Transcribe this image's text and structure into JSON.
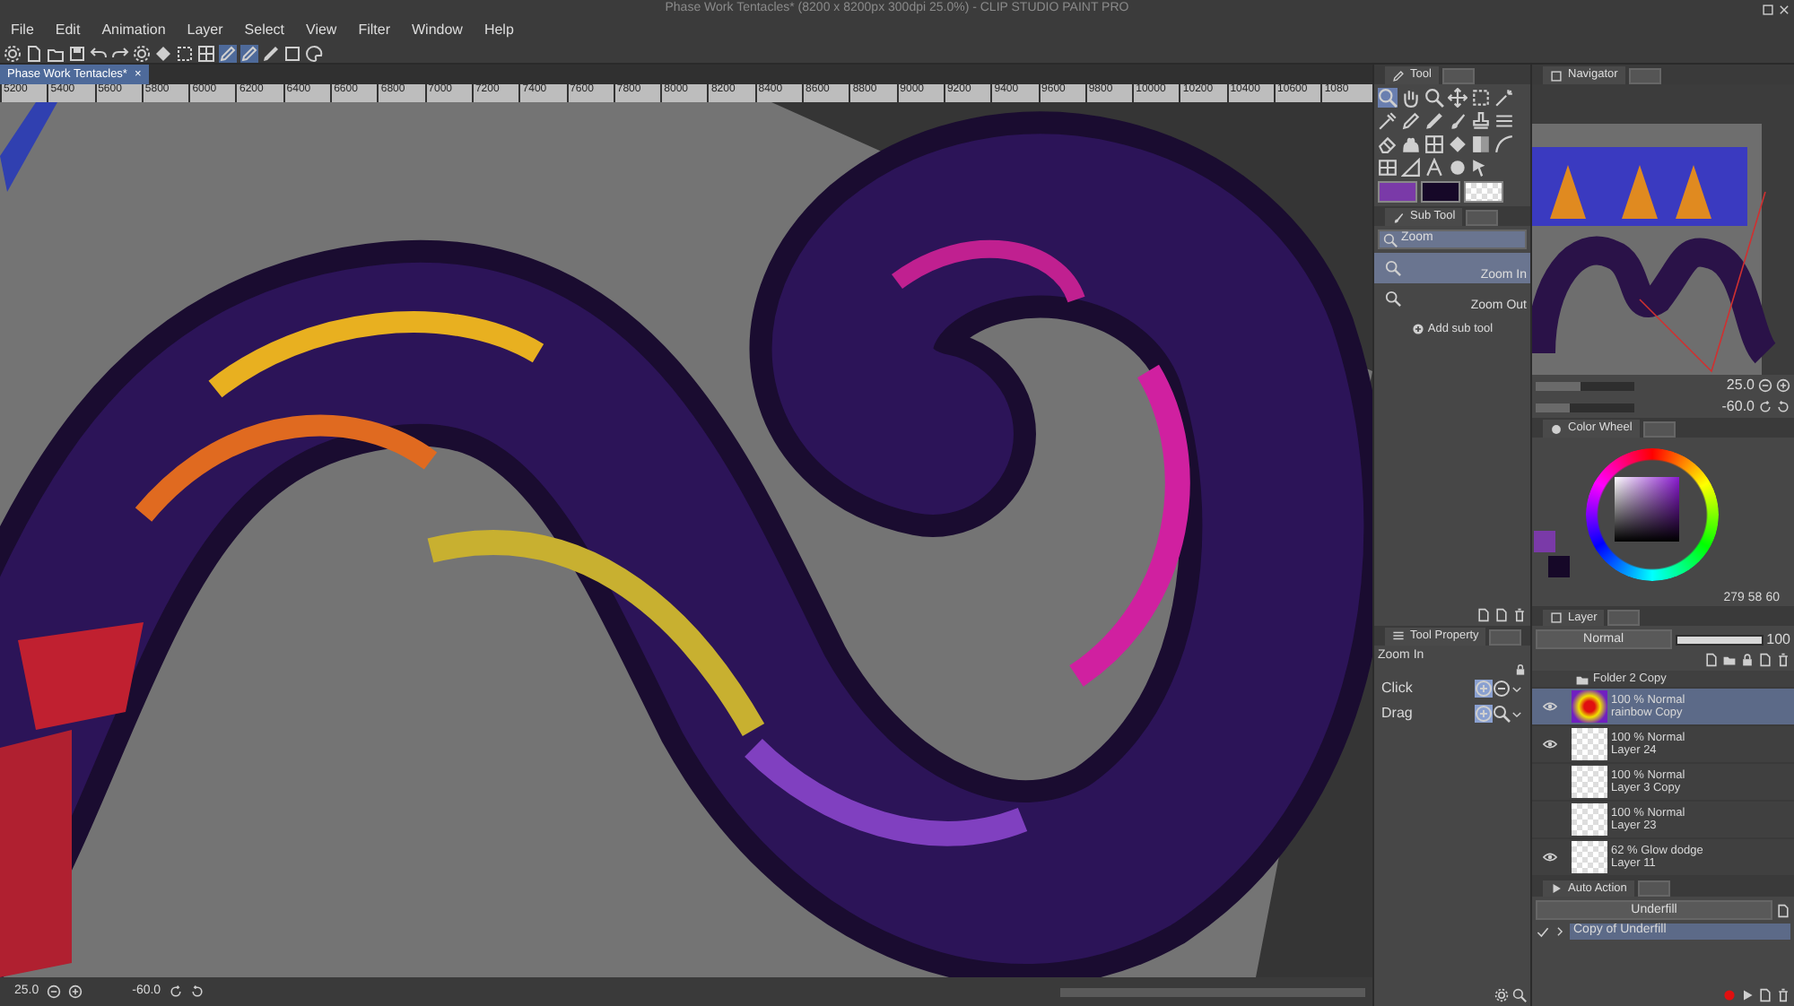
{
  "window": {
    "title": "Phase Work Tentacles* (8200 x 8200px 300dpi 25.0%) - CLIP STUDIO PAINT PRO"
  },
  "menu": [
    "File",
    "Edit",
    "Animation",
    "Layer",
    "Select",
    "View",
    "Filter",
    "Window",
    "Help"
  ],
  "document_tab": {
    "label": "Phase Work Tentacles*",
    "close": "×"
  },
  "ruler": [
    "5200",
    "5400",
    "5600",
    "5800",
    "6000",
    "6200",
    "6400",
    "6600",
    "6800",
    "7000",
    "7200",
    "7400",
    "7600",
    "7800",
    "8000",
    "8200",
    "8400",
    "8600",
    "8800",
    "9000",
    "9200",
    "9400",
    "9600",
    "9800",
    "10000",
    "10200",
    "10400",
    "10600",
    "1080"
  ],
  "status_bar": {
    "zoom": "25.0",
    "rotation": "-60.0"
  },
  "tool_panel": {
    "tab": "Tool"
  },
  "sub_tool": {
    "tab": "Sub Tool",
    "group": "Zoom",
    "items": [
      {
        "label": "Zoom In",
        "selected": true
      },
      {
        "label": "Zoom Out",
        "selected": false
      }
    ],
    "add": "Add sub tool"
  },
  "tool_property": {
    "tab": "Tool Property",
    "tool": "Zoom In",
    "rows": [
      "Click",
      "Drag"
    ]
  },
  "navigator": {
    "tab": "Navigator",
    "zoom": {
      "value": "25.0",
      "level": 0.45
    },
    "rotation": {
      "value": "-60.0",
      "level": 0.35
    }
  },
  "color_wheel": {
    "tab": "Color Wheel",
    "h": "279",
    "s": "58",
    "v": "60"
  },
  "layer_panel": {
    "tab": "Layer",
    "blend": "Normal",
    "opacity": {
      "value": "100",
      "level": 1
    }
  },
  "layers": [
    {
      "kind": "folder",
      "name": "Folder 2 Copy",
      "children": [
        {
          "kind": "layer",
          "mode": "100 % Normal",
          "name": "rainbow Copy",
          "visible": true,
          "selected": true
        },
        {
          "kind": "layer",
          "mode": "100 % Normal",
          "name": "Layer 24",
          "visible": true,
          "selected": false
        },
        {
          "kind": "layer",
          "mode": "100 % Normal",
          "name": "Layer 3 Copy",
          "visible": false,
          "selected": false
        },
        {
          "kind": "layer",
          "mode": "100 % Normal",
          "name": "Layer 23",
          "visible": false,
          "selected": false
        }
      ]
    },
    {
      "kind": "layer",
      "mode": "62 % Glow dodge",
      "name": "Layer 11",
      "visible": true,
      "selected": false
    }
  ],
  "auto_action": {
    "tab": "Auto Action",
    "set": "Underfill",
    "items": [
      {
        "label": "Copy of Underfill",
        "checked": true,
        "selected": true
      }
    ]
  }
}
